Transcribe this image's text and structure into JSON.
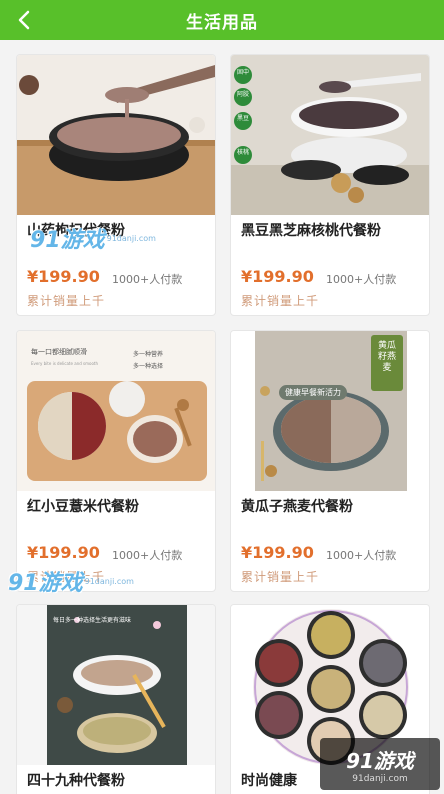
{
  "header": {
    "title": "生活用品",
    "back_icon": "chevron-left-icon"
  },
  "products": [
    {
      "name": "山药枸杞代餐粉",
      "price": "¥199.90",
      "buyers": "1000+人付款",
      "sales": "累计销量上千"
    },
    {
      "name": "黑豆黑芝麻核桃代餐粉",
      "price": "¥199.90",
      "buyers": "1000+人付款",
      "sales": "累计销量上千",
      "image_tags": [
        "固中",
        "阿胶",
        "黑豆",
        "核桃"
      ]
    },
    {
      "name": "红小豆薏米代餐粉",
      "price": "¥199.90",
      "buyers": "1000+人付款",
      "sales": "累计销量上千",
      "image_text": {
        "headline": "每一口都细腻顺滑",
        "sub": "Every bite is delicate and smooth",
        "tag1": "多一种营养",
        "tag2": "多一种选择"
      }
    },
    {
      "name": "黄瓜子燕麦代餐粉",
      "price": "¥199.90",
      "buyers": "1000+人付款",
      "sales": "累计销量上千",
      "image_text": {
        "banner": "健康早餐新活力",
        "side": "黄瓜籽燕麦"
      }
    },
    {
      "name": "四十九种代餐粉",
      "image_text": {
        "banner": "每日多一种选择生活更有滋味"
      }
    },
    {
      "name": "时尚健康"
    }
  ],
  "watermarks": {
    "mark": "91游戏",
    "sub": "91danji.com"
  },
  "colors": {
    "accent": "#58c02a",
    "price": "#e26f2c",
    "sales": "#d09b7a"
  }
}
